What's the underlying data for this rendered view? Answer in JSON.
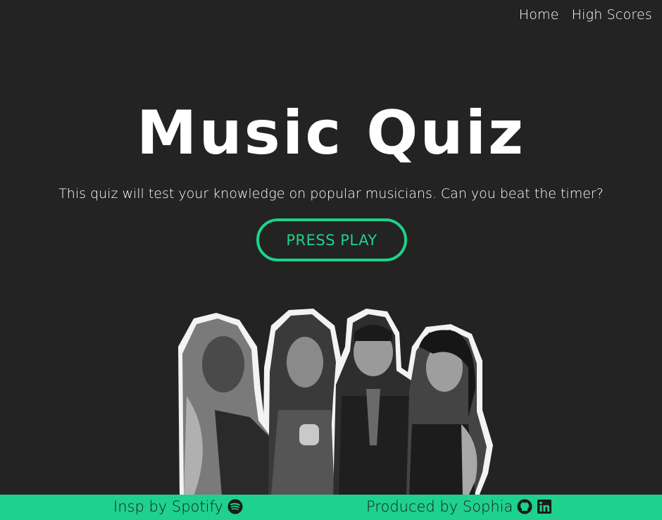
{
  "nav": {
    "home_label": "Home",
    "high_scores_label": "High Scores"
  },
  "hero": {
    "title": "Music Quiz",
    "subtitle": "This quiz will test your knowledge on popular musicians. Can you beat the timer?",
    "play_button_label": "PRESS PLAY"
  },
  "artists_image": {
    "icon": "musician-collage"
  },
  "footer": {
    "left_text": "Insp by Spotify",
    "left_icon": "spotify-icon",
    "right_text": "Produced by Sophia",
    "right_icons": [
      "github-icon",
      "linkedin-icon"
    ]
  },
  "colors": {
    "background": "#222322",
    "accent": "#1ed18c",
    "text": "#ffffff"
  }
}
